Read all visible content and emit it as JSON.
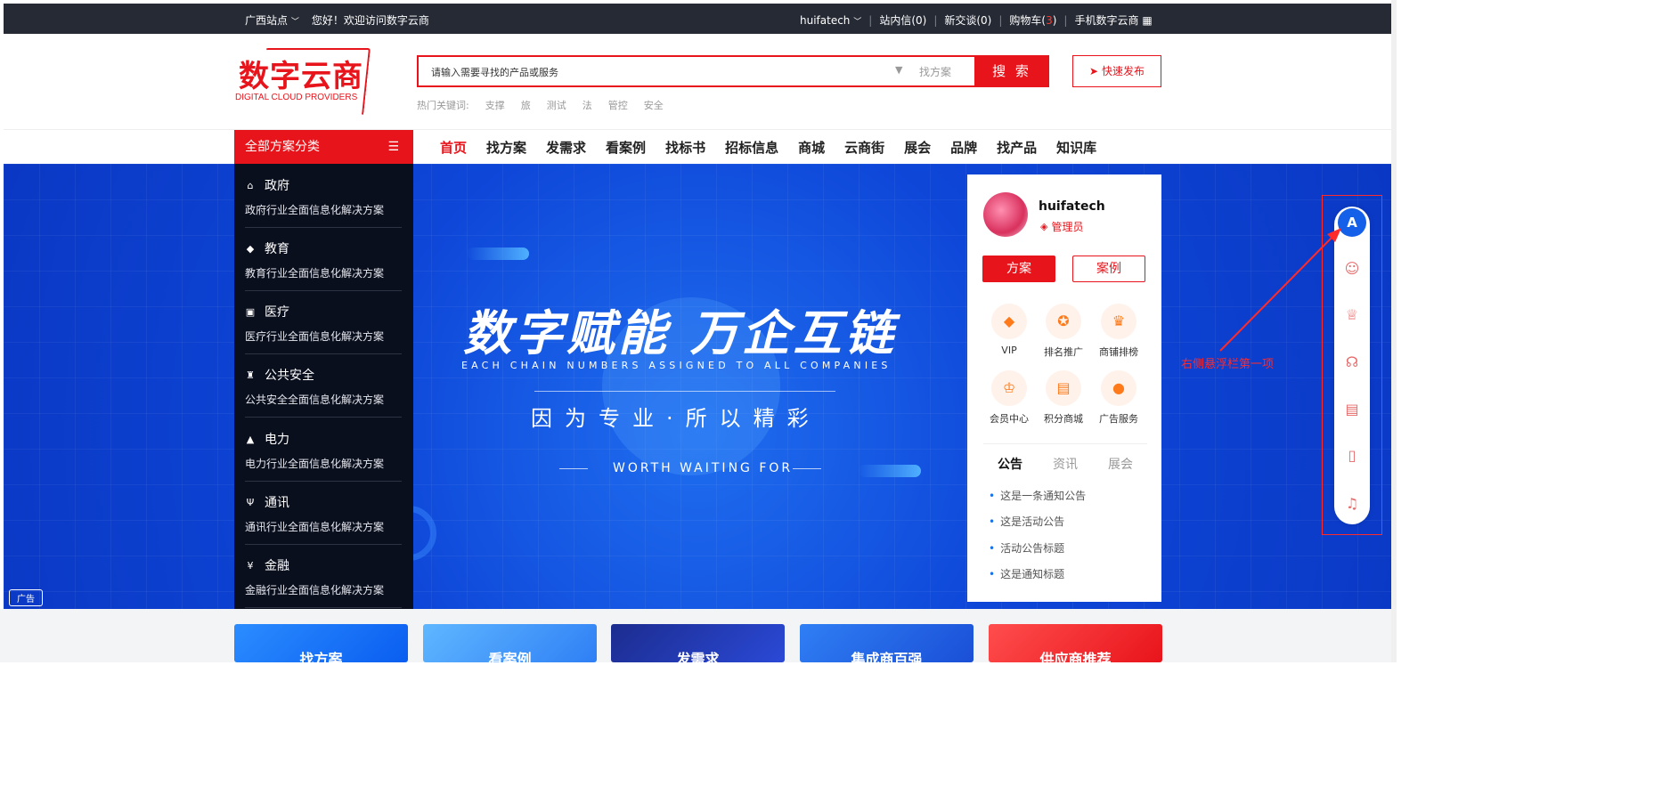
{
  "topbar": {
    "station": "广西站点",
    "welcome": "您好！欢迎访问数字云商",
    "user": "huifatech",
    "messages": "站内信(0)",
    "talks": "新交谈(0)",
    "cart_prefix": "购物车(",
    "cart_count": "3",
    "cart_suffix": ")",
    "mobile": "手机数字云商"
  },
  "logo": {
    "cn": "数字云商",
    "en": "DIGITAL CLOUD PROVIDERS"
  },
  "search": {
    "placeholder": "请输入需要寻找的产品或服务",
    "scope": "找方案",
    "button": "搜 索",
    "hot_label": "热门关键词:",
    "hot": [
      "支撑",
      "旅",
      "测试",
      "法",
      "管控",
      "安全"
    ]
  },
  "publish": "快速发布",
  "nav": {
    "all_categories": "全部方案分类",
    "items": [
      "首页",
      "找方案",
      "发需求",
      "看案例",
      "找标书",
      "招标信息",
      "商城",
      "云商街",
      "展会",
      "品牌",
      "找产品",
      "知识库"
    ]
  },
  "categories": [
    {
      "title": "政府",
      "desc": "政府行业全面信息化解决方案",
      "icon": "government-icon"
    },
    {
      "title": "教育",
      "desc": "教育行业全面信息化解决方案",
      "icon": "education-icon"
    },
    {
      "title": "医疗",
      "desc": "医疗行业全面信息化解决方案",
      "icon": "medical-icon"
    },
    {
      "title": "公共安全",
      "desc": "公共安全全面信息化解决方案",
      "icon": "police-icon"
    },
    {
      "title": "电力",
      "desc": "电力行业全面信息化解决方案",
      "icon": "warning-icon"
    },
    {
      "title": "通讯",
      "desc": "通讯行业全面信息化解决方案",
      "icon": "antenna-icon"
    },
    {
      "title": "金融",
      "desc": "金融行业全面信息化解决方案",
      "icon": "yen-icon"
    }
  ],
  "banner": {
    "slogan": "数字赋能 万企互链",
    "slogan_en": "EACH CHAIN NUMBERS ASSIGNED TO ALL COMPANIES",
    "slogan2": "因为专业·所以精彩",
    "worth": "WORTH WAITING FOR",
    "ad": "广告"
  },
  "usercard": {
    "name": "huifatech",
    "role": "管理员",
    "tab_active": "方案",
    "tab_inactive": "案例",
    "features": [
      "VIP",
      "排名推广",
      "商铺排榜",
      "会员中心",
      "积分商城",
      "广告服务"
    ],
    "notice_tabs": [
      "公告",
      "资讯",
      "展会"
    ],
    "notices": [
      "这是一条通知公告",
      "这是活动公告",
      "活动公告标题",
      "这是通知标题"
    ]
  },
  "floatbar": {
    "annotation": "右侧悬浮栏第一项",
    "items": [
      "logo-icon",
      "user-icon",
      "plus-crown-icon",
      "headset-icon",
      "document-icon",
      "phone-icon",
      "bell-icon"
    ],
    "logo_glyph": "A"
  },
  "cards": [
    "找方案",
    "看案例",
    "发需求",
    "集成商百强",
    "供应商推荐"
  ],
  "colors": {
    "accent": "#e8141b",
    "topbar": "#262a35",
    "float_active": "#1560e8"
  }
}
